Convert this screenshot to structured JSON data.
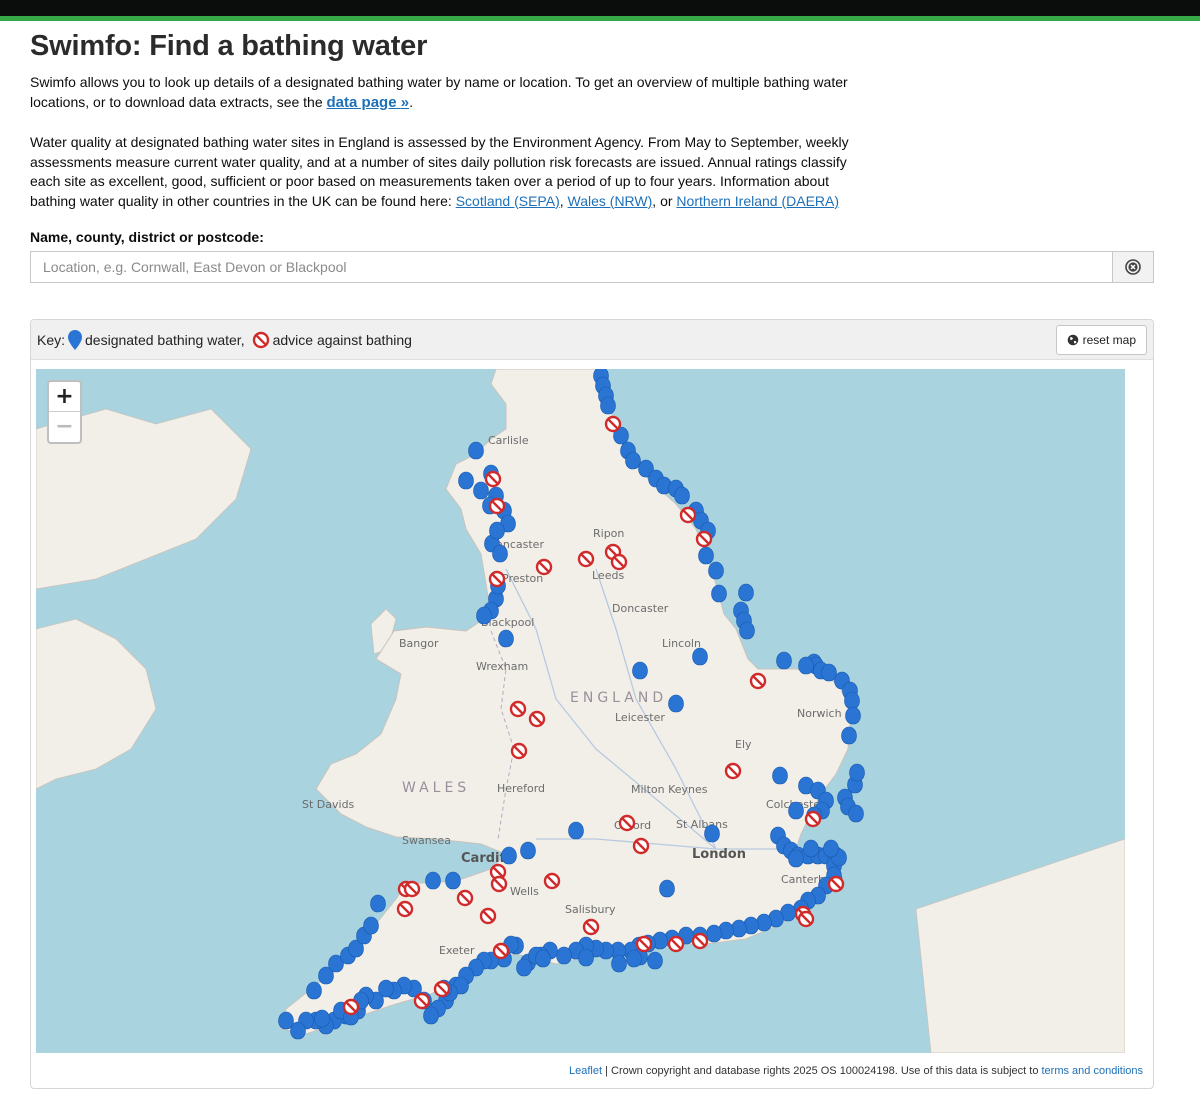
{
  "page": {
    "title": "Swimfo: Find a bathing water",
    "intro1_pre": "Swimfo allows you to look up details of a designated bathing water by name or location. To get an overview of multiple bathing water locations, or to download data extracts, see the ",
    "data_page_link": "data page",
    "data_page_suffix": "»",
    "intro1_post": ".",
    "intro2": "Water quality at designated bathing water sites in England is assessed by the Environment Agency. From May to September, weekly assessments measure current water quality, and at a number of sites daily pollution risk forecasts are issued. Annual ratings classify each site as excellent, good, sufficient or poor based on measurements taken over a period of up to four years. Information about bathing water quality in other countries in the UK can be found here: ",
    "links": {
      "scotland": "Scotland (SEPA)",
      "wales": "Wales (NRW)",
      "or": ", or ",
      "comma": ", ",
      "ni": "Northern Ireland (DAERA)"
    }
  },
  "search": {
    "label": "Name, county, district or postcode:",
    "placeholder": "Location, e.g. Cornwall, East Devon or Blackpool",
    "value": ""
  },
  "map": {
    "key_label": "Key:",
    "key_bathing": "designated bathing water,",
    "key_advice": "advice against bathing",
    "reset_label": "reset map",
    "zoom_in": "+",
    "zoom_out": "−",
    "attribution_leaflet": "Leaflet",
    "attribution_text": " | Crown copyright and database rights 2025 OS 100024198. Use of this data is subject to ",
    "attribution_terms": "terms and conditions",
    "colors": {
      "sea": "#a9d3df",
      "land": "#f2efe9",
      "pin": "#2a75d3",
      "advice": "#d12a2a"
    },
    "place_labels": {
      "carlisle": "Carlisle",
      "lancaster": "Lancaster",
      "preston": "Preston",
      "blackpool": "Blackpool",
      "ripon": "Ripon",
      "leeds": "Leeds",
      "doncaster": "Doncaster",
      "lincoln": "Lincoln",
      "bangor": "Bangor",
      "wrexham": "Wrexham",
      "england": "ENGLAND",
      "leicester": "Leicester",
      "norwich": "Norwich",
      "ely": "Ely",
      "wales": "WALES",
      "hereford": "Hereford",
      "milton_keynes": "Milton Keynes",
      "st_davids": "St Davids",
      "colchester": "Colchester",
      "oxford": "Oxford",
      "st_albans": "St Albans",
      "swansea": "Swansea",
      "cardiff": "Cardiff",
      "london": "London",
      "wells": "Wells",
      "canterbury": "Canterbury",
      "salisbury": "Salisbury",
      "exeter": "Exeter"
    },
    "bathing_waters": 220,
    "advice_against": 38
  }
}
